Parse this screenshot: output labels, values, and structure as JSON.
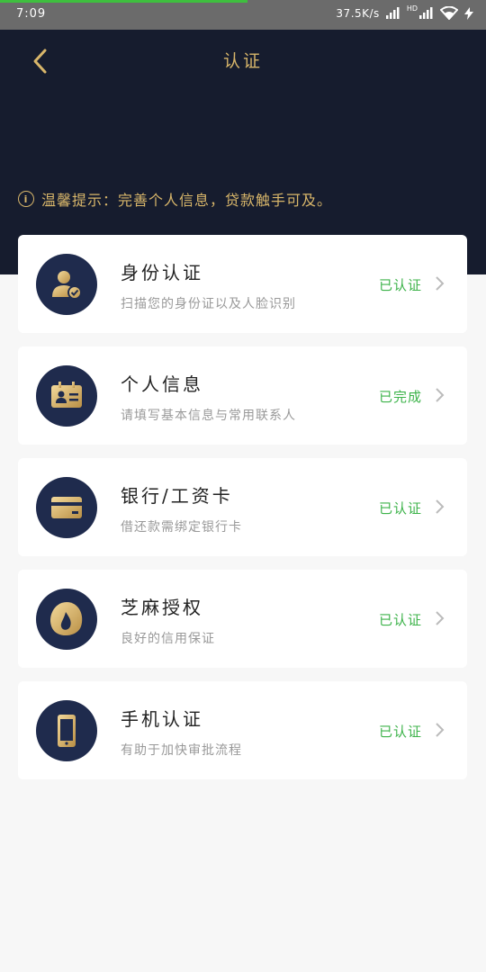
{
  "status_bar": {
    "time": "7:09",
    "speed": "37.5K/s",
    "hd": "HD"
  },
  "header": {
    "title": "认证",
    "notice": "温馨提示：完善个人信息，贷款触手可及。"
  },
  "colors": {
    "header_bg": "#161c2e",
    "gold": "#d8b66a",
    "status_green": "#3db34a",
    "icon_circle": "#1f2b4d"
  },
  "items": [
    {
      "title": "身份认证",
      "subtitle": "扫描您的身份证以及人脸识别",
      "status": "已认证",
      "icon": "user-check-icon"
    },
    {
      "title": "个人信息",
      "subtitle": "请填写基本信息与常用联系人",
      "status": "已完成",
      "icon": "id-card-icon"
    },
    {
      "title": "银行/工资卡",
      "subtitle": "借还款需绑定银行卡",
      "status": "已认证",
      "icon": "bank-card-icon"
    },
    {
      "title": "芝麻授权",
      "subtitle": "良好的信用保证",
      "status": "已认证",
      "icon": "sesame-icon"
    },
    {
      "title": "手机认证",
      "subtitle": "有助于加快审批流程",
      "status": "已认证",
      "icon": "phone-icon"
    }
  ]
}
